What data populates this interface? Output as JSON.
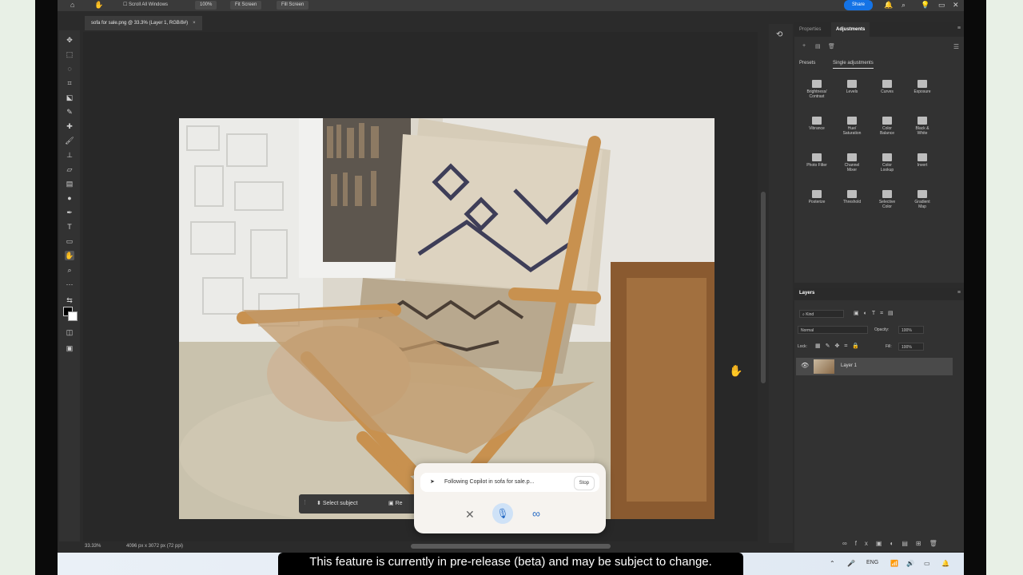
{
  "options_bar": {
    "scroll_all_windows": "Scroll All Windows",
    "zoom": "100%",
    "fit_screen": "Fit Screen",
    "fill_screen": "Fill Screen",
    "share": "Share"
  },
  "document_tab": {
    "title": "sofa for sale.png @ 33.3% (Layer 1, RGB/8#)"
  },
  "context_bar": {
    "select_subject": "Select subject",
    "remove_bg": "Re"
  },
  "copilot": {
    "status": "Following Copilot in sofa for sale.p...",
    "stop": "Stop"
  },
  "status_bar": {
    "zoom": "33.33%",
    "dimensions": "4096 px x 3072 px (72 ppi)"
  },
  "properties_panel": {
    "tabs": [
      "Properties",
      "Adjustments"
    ],
    "subtabs": [
      "Presets",
      "Single adjustments"
    ],
    "adjustments": [
      [
        "Brightness/\nContrast",
        "Levels",
        "Curves",
        "Exposure"
      ],
      [
        "Vibrance",
        "Hue/\nSaturation",
        "Color\nBalance",
        "Black &\nWhite"
      ],
      [
        "Photo Filter",
        "Channel\nMixer",
        "Color\nLookup",
        "Invert"
      ],
      [
        "Posterize",
        "Threshold",
        "Selective\nColor",
        "Gradient\nMap"
      ]
    ]
  },
  "layers_panel": {
    "title": "Layers",
    "kind": "Kind",
    "blend_mode": "Normal",
    "opacity_label": "Opacity:",
    "opacity_value": "100%",
    "lock_label": "Lock:",
    "fill_label": "Fill:",
    "fill_value": "100%",
    "layer_name": "Layer 1"
  },
  "taskbar": {
    "language": "ENG"
  },
  "caption": {
    "line1": "This feature is currently in pre-release (beta) and may be subject to change."
  }
}
